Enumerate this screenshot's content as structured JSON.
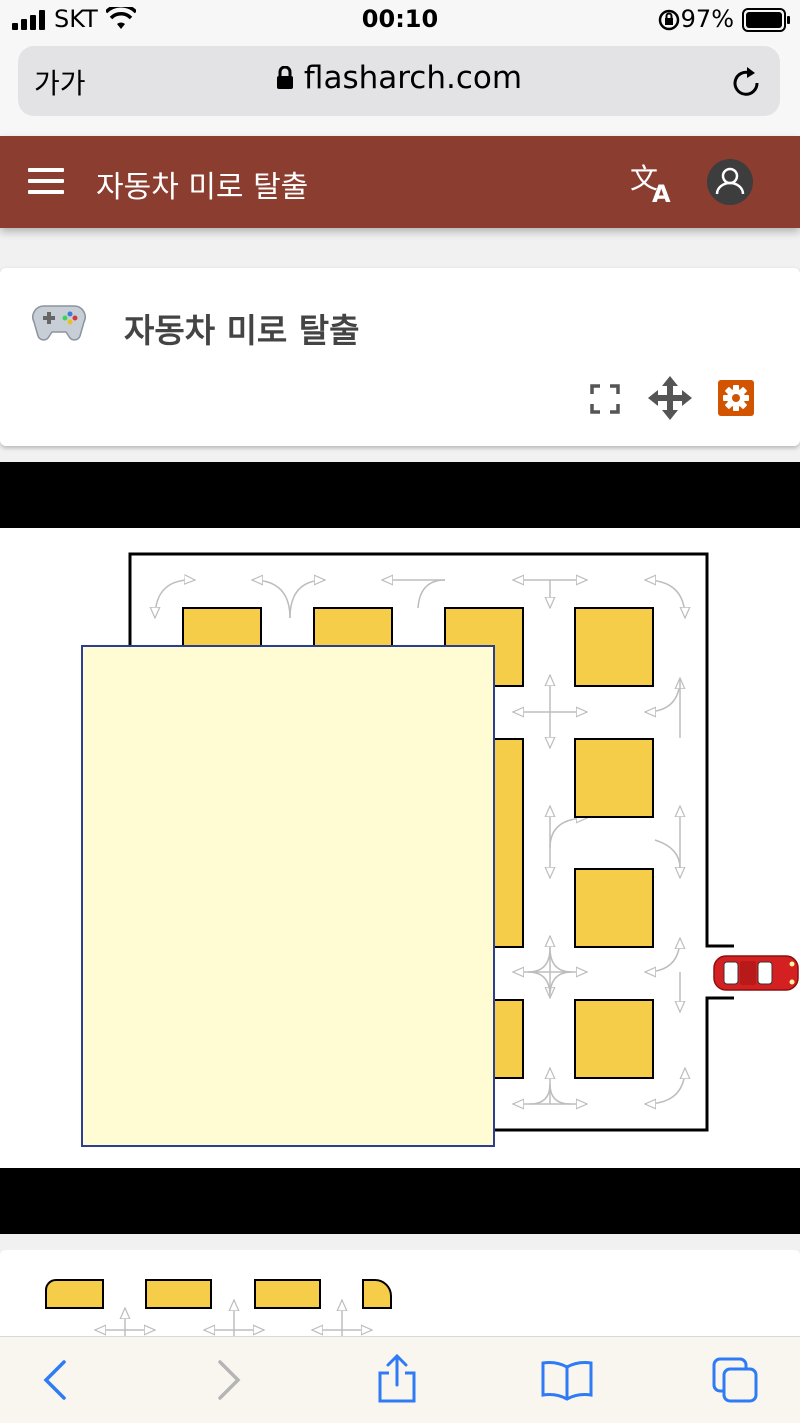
{
  "status": {
    "carrier": "SKT",
    "time": "00:10",
    "battery_percent": "97%"
  },
  "browser": {
    "text_size_button": "가가",
    "url": "flasharch.com"
  },
  "header": {
    "title": "자동차 미로 탈출"
  },
  "game_card": {
    "title": "자동차 미로 탈출",
    "icons": [
      "fullscreen-icon",
      "move-icon",
      "settings-icon"
    ],
    "settings_color": "#d35400"
  },
  "colors": {
    "header_bg": "#8b3d30",
    "block_fill": "#f5cd48",
    "overlay_fill": "#fffbd3",
    "overlay_border": "#2a3f8f",
    "car": "#d42020",
    "toolbar_blue": "#2f7bf5"
  },
  "toolbar": {
    "icons": [
      "back-icon",
      "forward-icon",
      "share-icon",
      "bookmarks-icon",
      "tabs-icon"
    ]
  }
}
